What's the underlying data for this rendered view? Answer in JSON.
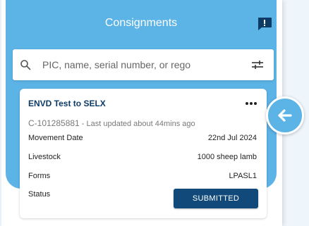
{
  "header": {
    "title": "Consignments",
    "icon": "chat-alert-icon"
  },
  "search": {
    "placeholder": "PIC, name, serial number, or rego",
    "icon": "search-icon",
    "filter_icon": "filter-sliders-icon"
  },
  "card": {
    "title": "ENVD Test to SELX",
    "id": "C-101285881",
    "updated": " - Last updated about 44mins ago",
    "rows": [
      {
        "label": "Movement Date",
        "value": "22nd Jul 2024"
      },
      {
        "label": "Livestock",
        "value": "1000 sheep lamb"
      },
      {
        "label": "Forms",
        "value": "LPASL1"
      }
    ],
    "status_label": "Status",
    "status_value": "SUBMITTED"
  },
  "colors": {
    "accent": "#5cb3e6",
    "dark_blue": "#114a7a",
    "title_blue": "#0d3b66"
  },
  "back_button_icon": "arrow-left-icon"
}
